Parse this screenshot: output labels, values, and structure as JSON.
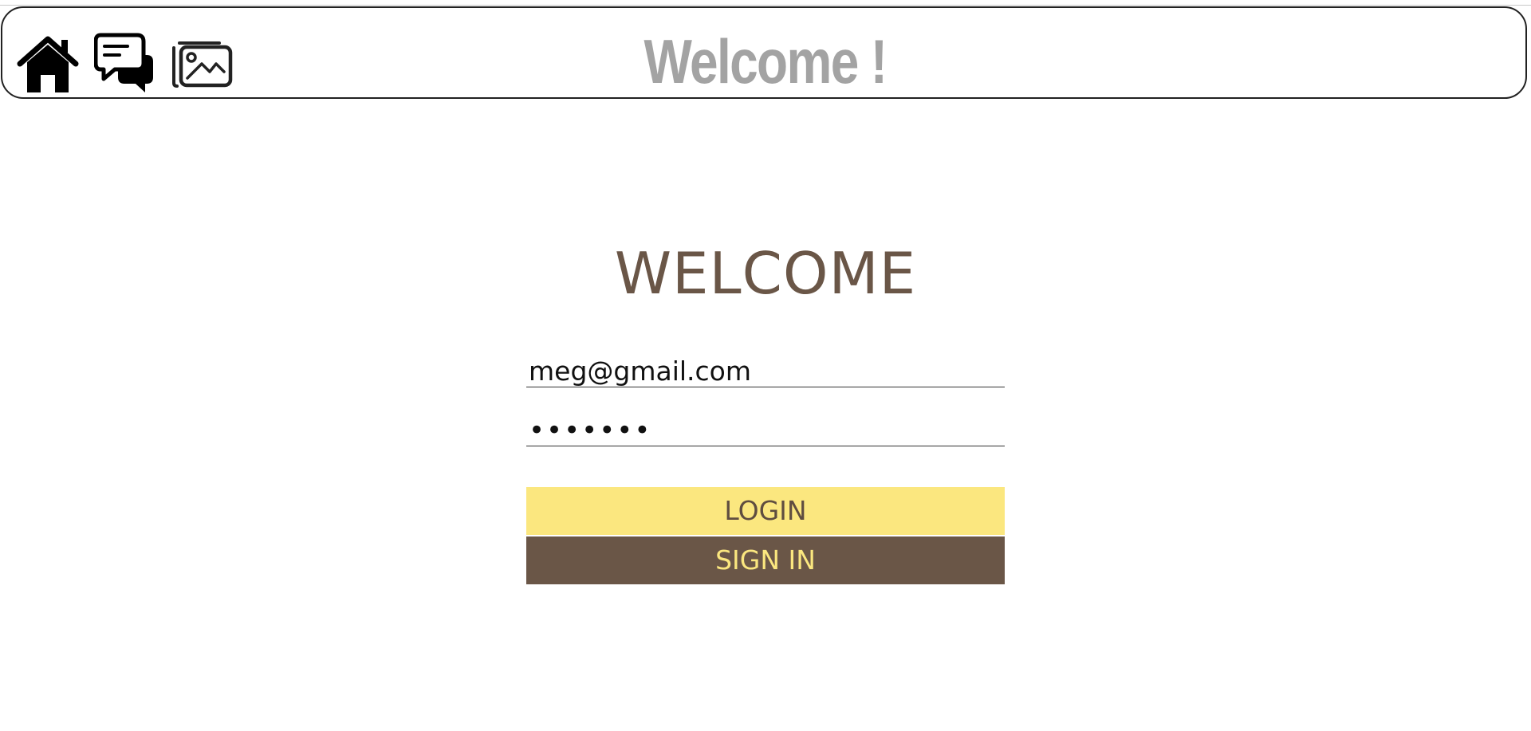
{
  "header": {
    "title": "Welcome !",
    "icons": [
      "home-icon",
      "chat-icon",
      "gallery-icon"
    ]
  },
  "login_form": {
    "title": "WELCOME",
    "email_value": "meg@gmail.com",
    "password_value": "•••••••",
    "login_label": "LOGIN",
    "signin_label": "SIGN IN"
  },
  "colors": {
    "header_title": "#a3a3a3",
    "brown": "#6a5647",
    "yellow": "#fbe77f"
  }
}
